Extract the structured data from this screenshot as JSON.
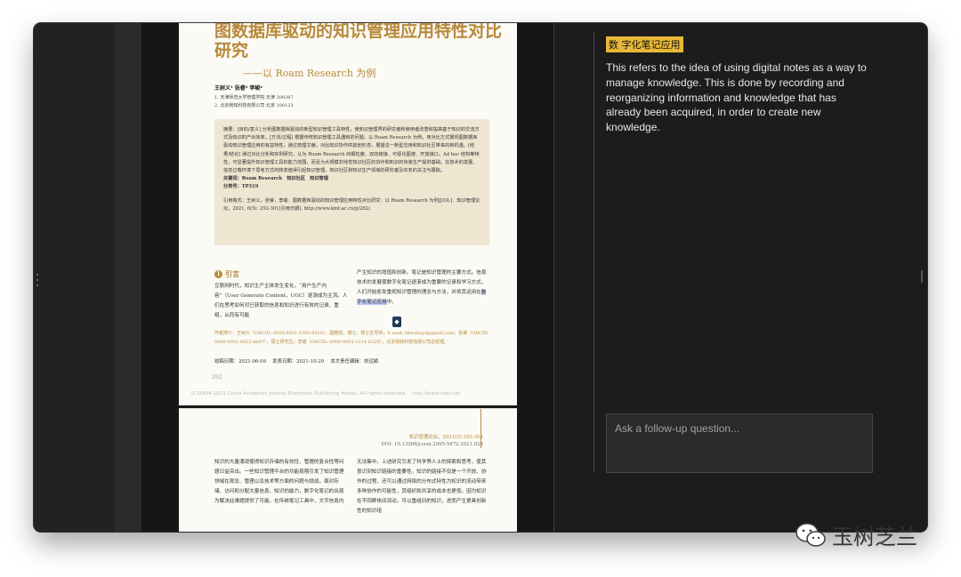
{
  "pdf": {
    "title": "图数据库驱动的知识管理应用特性对比研究",
    "subtitle": "——以 Roam Research 为例",
    "authors": "王树义¹ 张睿² 李峻²",
    "affiliation_1": "1. 天津师范大学管理学院 天津 300387",
    "affiliation_2": "2. 北京我知科技有限公司 北京 100123",
    "abstract": "摘要：[目的/意义] 分析图数据库驱动的新型知识管理工具特性，使知识管理界的研究者和使用者改善和提高基于知识的交流方式及知识的产出效率。[方法/过程] 根据传统知识管理工具遇到的问题，以 Roam Research 为例，用对比方式展现图数据库驱动知识管理应用的有益特性，通过梳理文献，对比知识协作的其他形态，展望这一新型应用和知识社区带来的新机遇。[结果/结论] 通过对比分析和实例研究，认为 Roam Research 的细粒度、双向链接、可视化图谱、开放接口、Ad hoc 结构等特性，可显著提升知识管理工具的能力范围，而且为大规模非线性知识社区的协作和知识的快速生产提供基础。在技术的发展、信息过载环境下思考方式的转变值得引起知识管理、知识社区和知识生产领域的研究者及实务的关注与跟踪。",
    "keywords": "关键词：Roam Research　知识社区　知识管理",
    "classification": "分类号：TP319",
    "citation": "引用格式：王树义，张睿，李峻．图数据库驱动的知识管理应用特性对比研究：以 Roam Research 为例[J/OL]．知识管理论坛，2021, 6(5): 292-301[引用日期]. http://www.kmf.ac.cn/p/262/.",
    "section_num": "1",
    "section_title": "引言",
    "col_left": "互联网时代，知识生产主体发生变化，“用户生产内容”（User Generate Content，UGC）逐渐成为主流。人们在思考如何对已获取的信息和知识进行有效的记录、重组，从而有可能",
    "col_right_a": "产生知识的增值和创新。笔记是知识管理的主要方式。信息技术的发展使数字化笔记逐渐成为重要的记录和学习方式，人们开始愈发重视知识管理的理念与方法，并将其运用在",
    "col_right_hl": "数字化笔记应用",
    "col_right_b": "中。",
    "author_info": "作者简介：王树义（ORCID: 0000-0001-5395-6416），副教授，博士，硕士生导师，E-mail: nkwshuyi@gmail.com；张睿（ORCID: 0000-0001-6823-8697），硕士研究生；李峻（ORCID: 0000-0003-1314-632X），北京我知科技有限公司总经理。",
    "received": "收稿日期：2021-06-09",
    "published": "发表日期：2021-10-29",
    "editor": "本文责任编辑：刘远颖",
    "page_number": "292",
    "copyright": "(C)1994-2021 China Academic Journal Electronic Publishing House. All rights reserved.　http://www.cnki.net",
    "float_icon": "logo-icon",
    "page2_journal": "知识管理论坛，2021(5):292-301",
    "page2_doi": "DOI: 10.13266/j.issn.2095-5472.2021.028",
    "page2_left": "知识的大量涌现使得知识存储的有效性、管理的复合性等问题日益突出。一些知识管理平台的功能局限引发了知识管理领域在观念、管理以及技术等方面的问题与挑战，面对存储、访问和分配大量信息、知识的能力，数字化笔记的出现为解决此难题提供了可能。在传统笔记工具中，文字信息内",
    "page2_right": "无法集中，上述研究引发了科学界人士的探索和思考，使其意识到知识链接的重要性。知识的链接不仅是一个开放、协作的过程，还可以通过网络的分布式特性为知识的流动带来多种协作的可能性，其组织和共享的成本也更低。因为知识在不同群体间流动，可以重组旧的知识，进而产生更具创新性的知识组"
  },
  "panel": {
    "tag": "数 字化笔记应用",
    "explanation": "This refers to the idea of using digital notes as a way to manage knowledge. This is done by recording and reorganizing information and knowledge that has already been acquired, in order to create new knowledge.",
    "input_placeholder": "Ask a follow-up question..."
  },
  "watermark": {
    "icon": "wechat-icon",
    "text": "玉树芝兰"
  },
  "colors": {
    "accent_gold": "#b8893a",
    "tag_yellow": "#e8b938",
    "highlight_blue": "#bcc9f2",
    "panel_bg": "#1c1c1c"
  }
}
